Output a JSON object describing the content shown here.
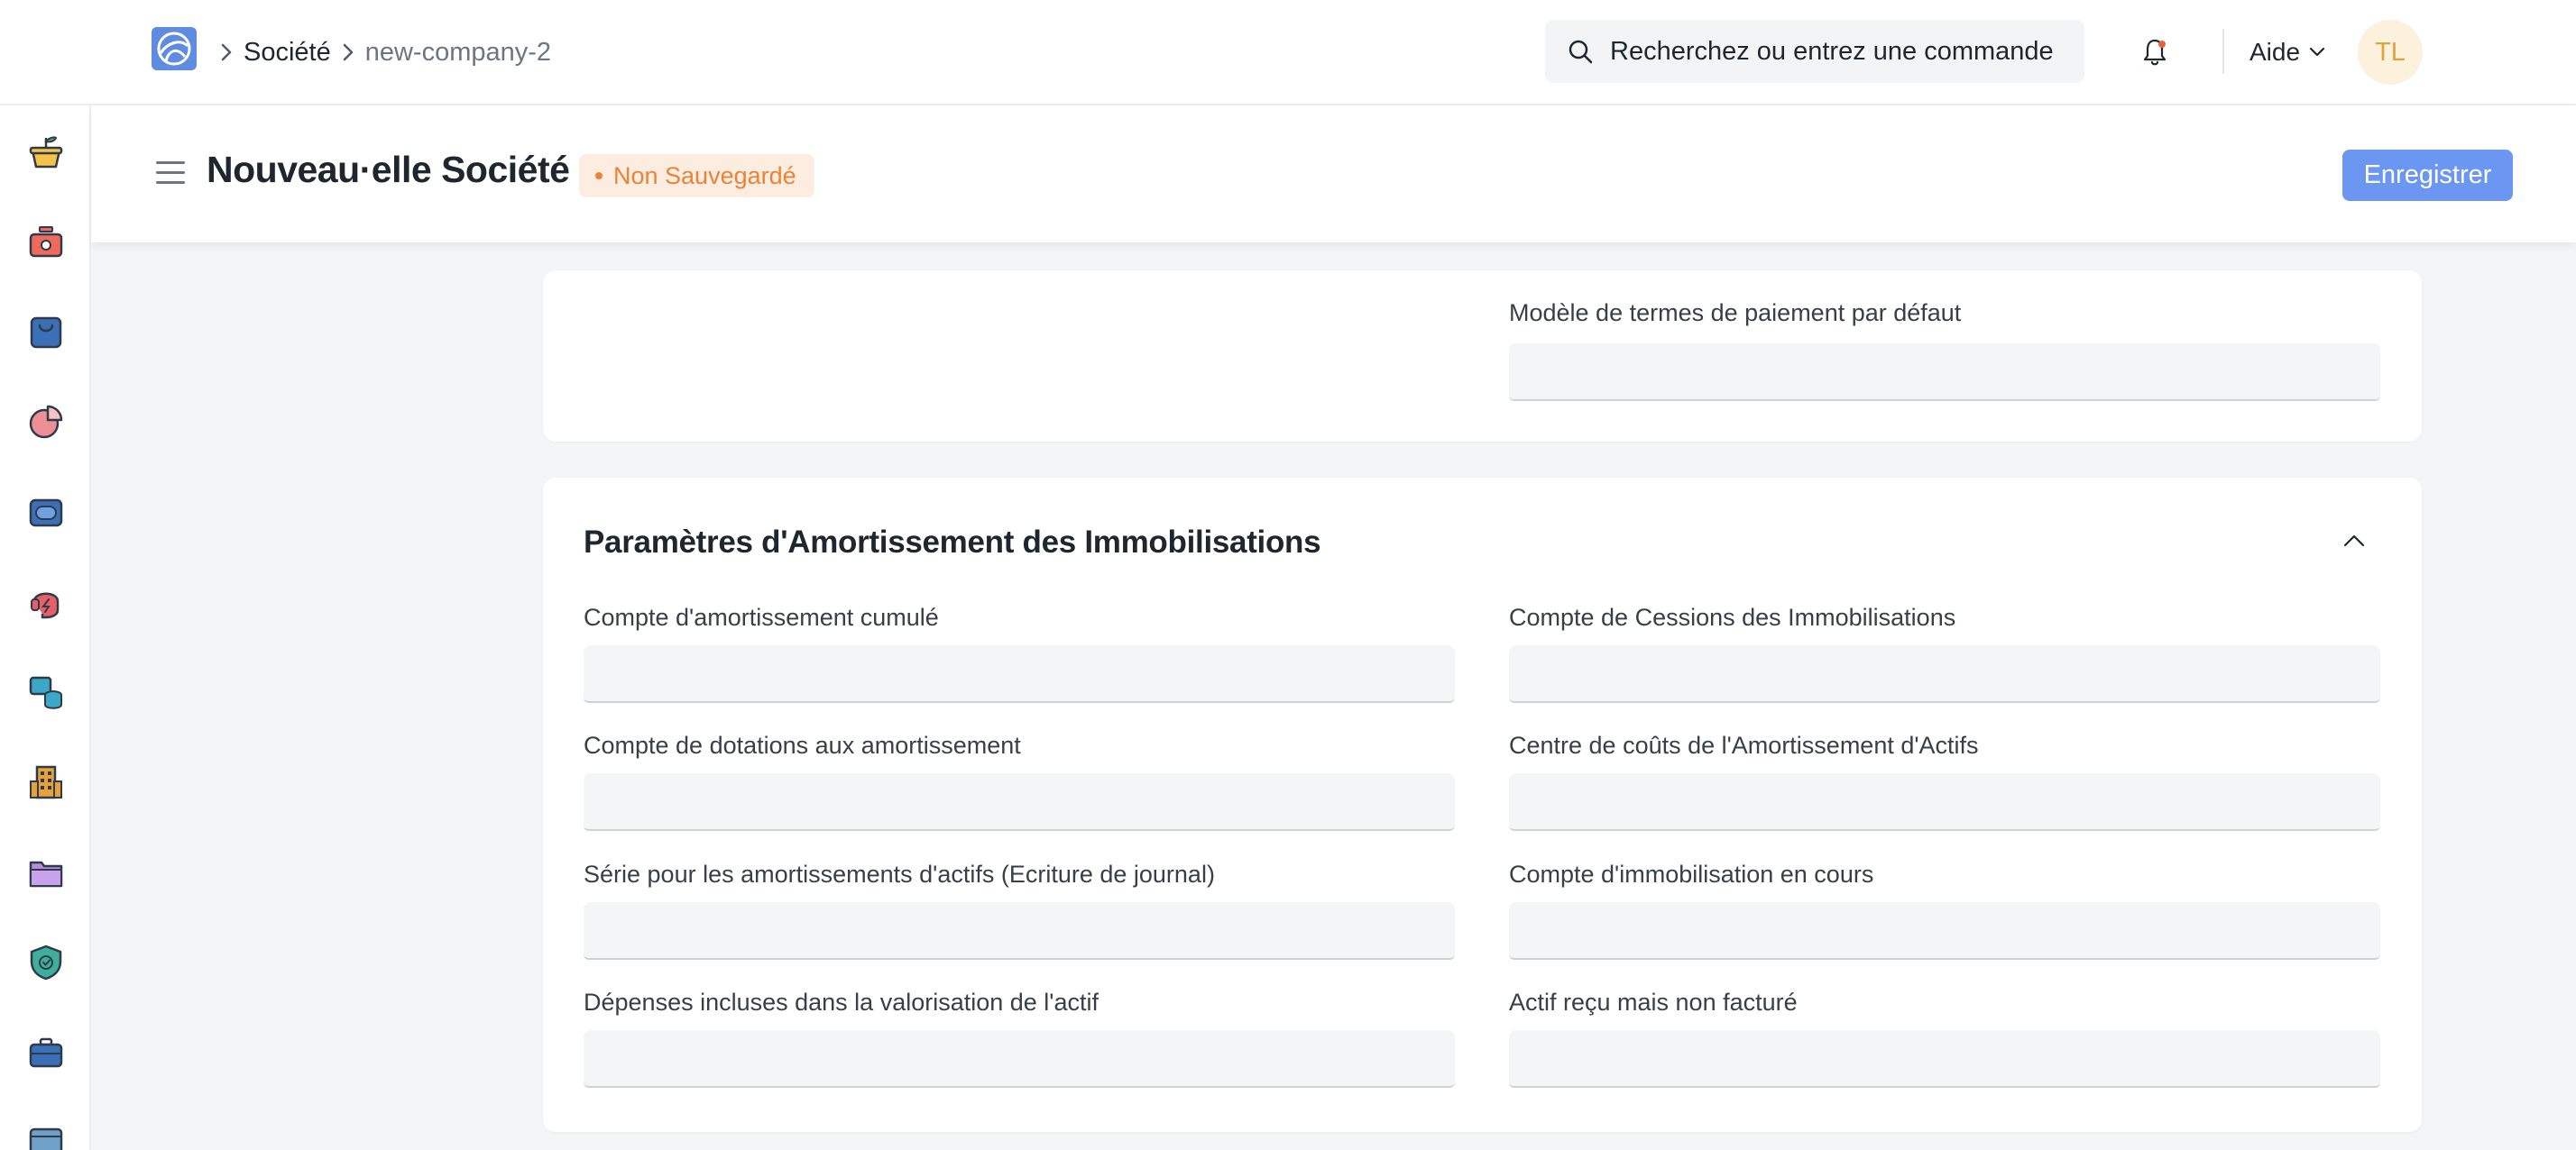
{
  "navbar": {
    "breadcrumb": [
      "Société",
      "new-company-2"
    ],
    "search_placeholder": "Recherchez ou entrez une commande",
    "help_label": "Aide",
    "avatar_initials": "TL"
  },
  "page": {
    "title": "Nouveau·elle Société",
    "status": "Non Sauvegardé",
    "save_label": "Enregistrer"
  },
  "section_payment": {
    "field_label": "Modèle de termes de paiement par défaut",
    "field_value": ""
  },
  "section_depreciation": {
    "title": "Paramètres d'Amortissement des Immobilisations",
    "fields": [
      {
        "label": "Compte d'amortissement cumulé",
        "value": ""
      },
      {
        "label": "Compte de Cessions des Immobilisations",
        "value": ""
      },
      {
        "label": "Compte de dotations aux amortissement",
        "value": ""
      },
      {
        "label": "Centre de coûts de l'Amortissement d'Actifs",
        "value": ""
      },
      {
        "label": "Série pour les amortissements d'actifs (Ecriture de journal)",
        "value": ""
      },
      {
        "label": "Compte d'immobilisation en cours",
        "value": ""
      },
      {
        "label": "Dépenses incluses dans la valorisation de l'actif",
        "value": ""
      },
      {
        "label": "Actif reçu mais non facturé",
        "value": ""
      }
    ]
  },
  "sidebar_icons": [
    "plant-icon",
    "cash-box-icon",
    "shopping-bag-icon",
    "pie-chart-icon",
    "inventory-icon",
    "support-icon",
    "database-icon",
    "building-icon",
    "folder-icon",
    "shield-check-icon",
    "briefcase-icon",
    "window-icon"
  ],
  "colors": {
    "accent": "#6b96f2",
    "status_orange": "#e8843a",
    "avatar_bg": "#fbf1dc"
  }
}
